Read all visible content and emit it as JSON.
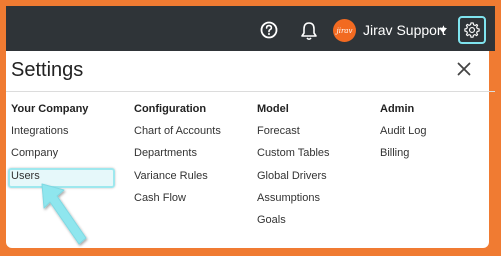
{
  "header": {
    "help_icon": "help-circle-icon",
    "bell_icon": "bell-icon",
    "avatar_text": "jirav",
    "user_name": "Jirav Support",
    "gear_icon": "gear-icon"
  },
  "settings": {
    "title": "Settings",
    "columns": [
      {
        "heading": "Your Company",
        "items": [
          "Integrations",
          "Company",
          "Users"
        ]
      },
      {
        "heading": "Configuration",
        "items": [
          "Chart of Accounts",
          "Departments",
          "Variance Rules",
          "Cash Flow"
        ]
      },
      {
        "heading": "Model",
        "items": [
          "Forecast",
          "Custom Tables",
          "Global Drivers",
          "Assumptions",
          "Goals"
        ]
      },
      {
        "heading": "Admin",
        "items": [
          "Audit Log",
          "Billing"
        ]
      }
    ]
  },
  "colors": {
    "frame": "#f07b32",
    "topbar": "#2f3438",
    "highlight": "#9ee8ee",
    "avatar": "#f26a21"
  }
}
